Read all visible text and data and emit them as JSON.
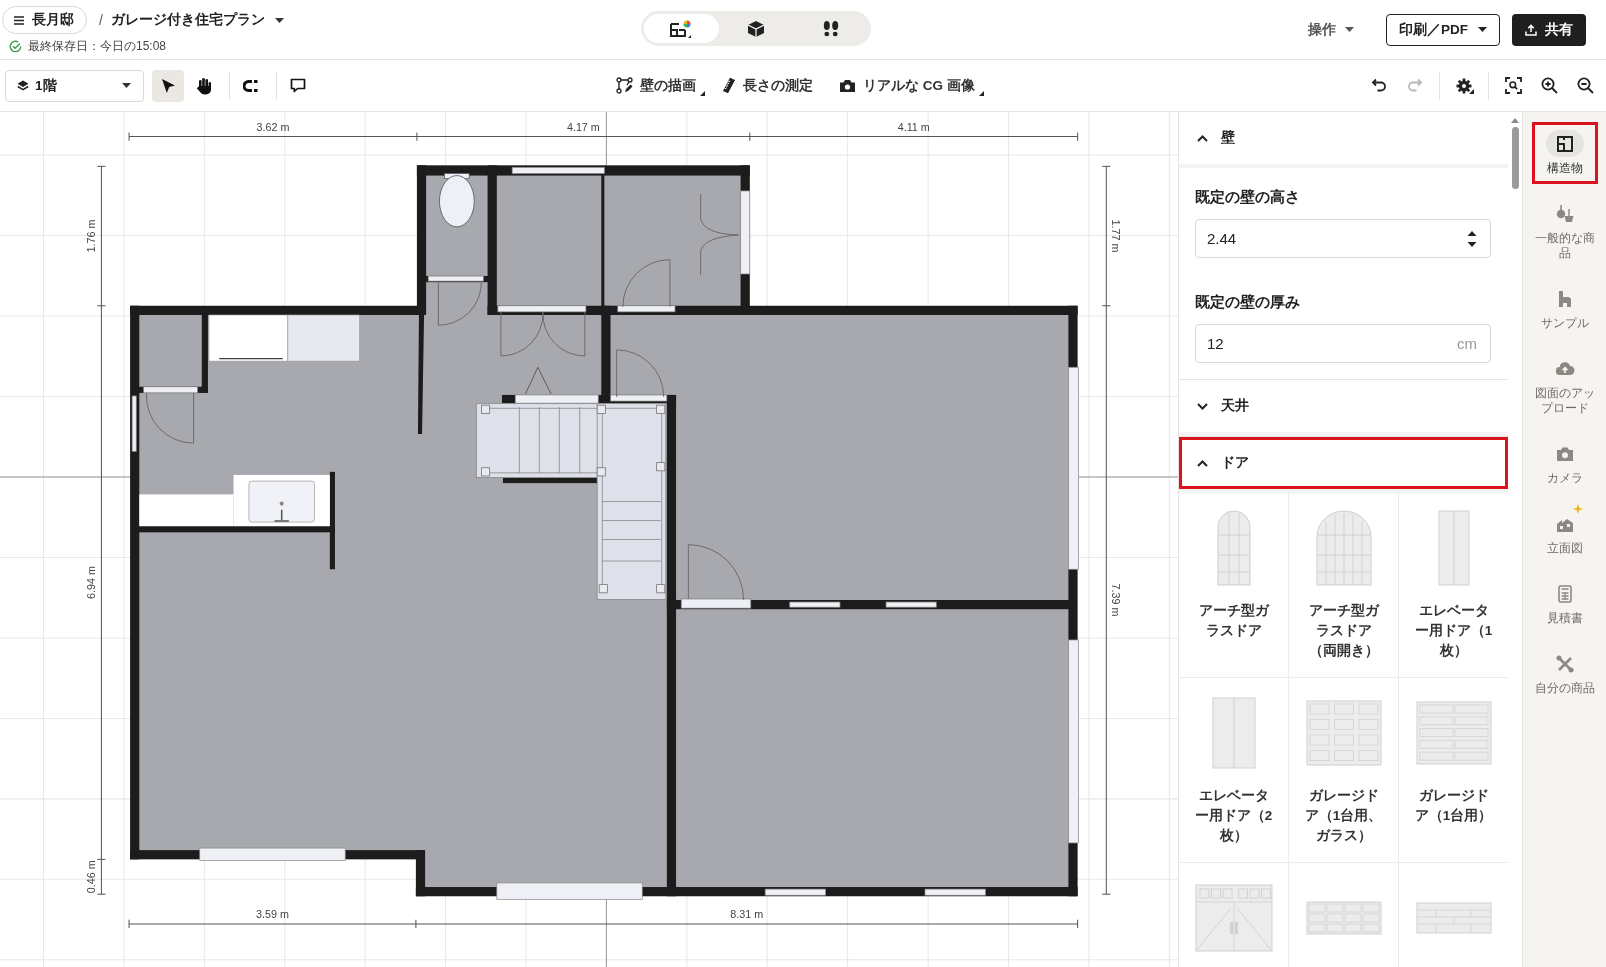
{
  "header": {
    "project": "長月邸",
    "separator": "/",
    "plan_title": "ガレージ付き住宅プラン",
    "saved": "最終保存日：今日の15:08",
    "view_modes": [
      {
        "kind": "plan",
        "selected": true
      },
      {
        "kind": "perspective",
        "selected": false
      },
      {
        "kind": "walk",
        "selected": false
      }
    ],
    "operations": "操作",
    "print": "印刷／PDF",
    "share": "共有"
  },
  "toolbar": {
    "level": "1階",
    "tools": [
      {
        "kind": "select",
        "selected": true
      },
      {
        "kind": "pan",
        "selected": false
      },
      {
        "kind": "snap",
        "selected": false
      },
      {
        "kind": "comment",
        "selected": false
      }
    ],
    "draw_tools": [
      {
        "kind": "wall",
        "label": "壁の描画",
        "has_menu": true
      },
      {
        "kind": "measure",
        "label": "長さの測定",
        "has_menu": false
      },
      {
        "kind": "render",
        "label": "リアルな CG 画像",
        "has_menu": true
      }
    ],
    "view_tools": [
      {
        "kind": "undo",
        "disabled": false,
        "has_menu": false
      },
      {
        "kind": "redo",
        "disabled": true,
        "has_menu": false
      },
      {
        "kind": "settings",
        "disabled": false,
        "has_menu": true
      },
      {
        "kind": "fit",
        "disabled": false,
        "has_menu": false
      },
      {
        "kind": "zoom_in",
        "disabled": false,
        "has_menu": false
      },
      {
        "kind": "zoom_out",
        "disabled": false,
        "has_menu": false
      }
    ]
  },
  "plan": {
    "dimensions": {
      "top": [
        "3.62 m",
        "4.17 m",
        "4.11 m"
      ],
      "bottom": [
        "3.59 m",
        "8.31 m"
      ],
      "left": [
        "1.76 m",
        "6.94 m",
        "0.46 m"
      ],
      "right": [
        "1.77 m",
        "7.39 m"
      ]
    }
  },
  "panel": {
    "sections": [
      {
        "title": "壁",
        "expanded": true,
        "highlighted": false,
        "fields": [
          {
            "kind": "stepper",
            "label": "既定の壁の高さ",
            "value": "2.44"
          },
          {
            "kind": "unit",
            "label": "既定の壁の厚み",
            "value": "12",
            "unit": "cm"
          }
        ]
      },
      {
        "title": "天井",
        "expanded": false,
        "highlighted": false
      },
      {
        "title": "ドア",
        "expanded": true,
        "highlighted": true,
        "items": [
          {
            "kind": "arch",
            "label": "アーチ型ガラスドア"
          },
          {
            "kind": "arch_double",
            "label": "アーチ型ガラスドア（両開き）"
          },
          {
            "kind": "elevator_single",
            "label": "エレベーター用ドア（1枚）"
          },
          {
            "kind": "elevator_double",
            "label": "エレベーター用ドア（2枚）"
          },
          {
            "kind": "garage_glass",
            "label": "ガレージドア（1台用、ガラス）"
          },
          {
            "kind": "garage",
            "label": "ガレージドア（1台用）"
          },
          {
            "kind": "garage_carriage"
          },
          {
            "kind": "garage_panel"
          },
          {
            "kind": "garage_flat"
          }
        ]
      }
    ]
  },
  "sidebar": {
    "items": [
      {
        "kind": "structure",
        "label": "構造物",
        "selected": true,
        "highlighted": true,
        "new": false
      },
      {
        "kind": "products",
        "label": "一般的な商品",
        "selected": false,
        "highlighted": false,
        "new": false
      },
      {
        "kind": "samples",
        "label": "サンプル",
        "selected": false,
        "highlighted": false,
        "new": false
      },
      {
        "kind": "upload",
        "label": "図面のアップロード",
        "selected": false,
        "highlighted": false,
        "new": false
      },
      {
        "kind": "camera",
        "label": "カメラ",
        "selected": false,
        "highlighted": false,
        "new": false
      },
      {
        "kind": "elevation",
        "label": "立面図",
        "selected": false,
        "highlighted": false,
        "new": true
      },
      {
        "kind": "estimate",
        "label": "見積書",
        "selected": false,
        "highlighted": false,
        "new": false
      },
      {
        "kind": "my_products",
        "label": "自分の商品",
        "selected": false,
        "highlighted": false,
        "new": false
      }
    ]
  }
}
